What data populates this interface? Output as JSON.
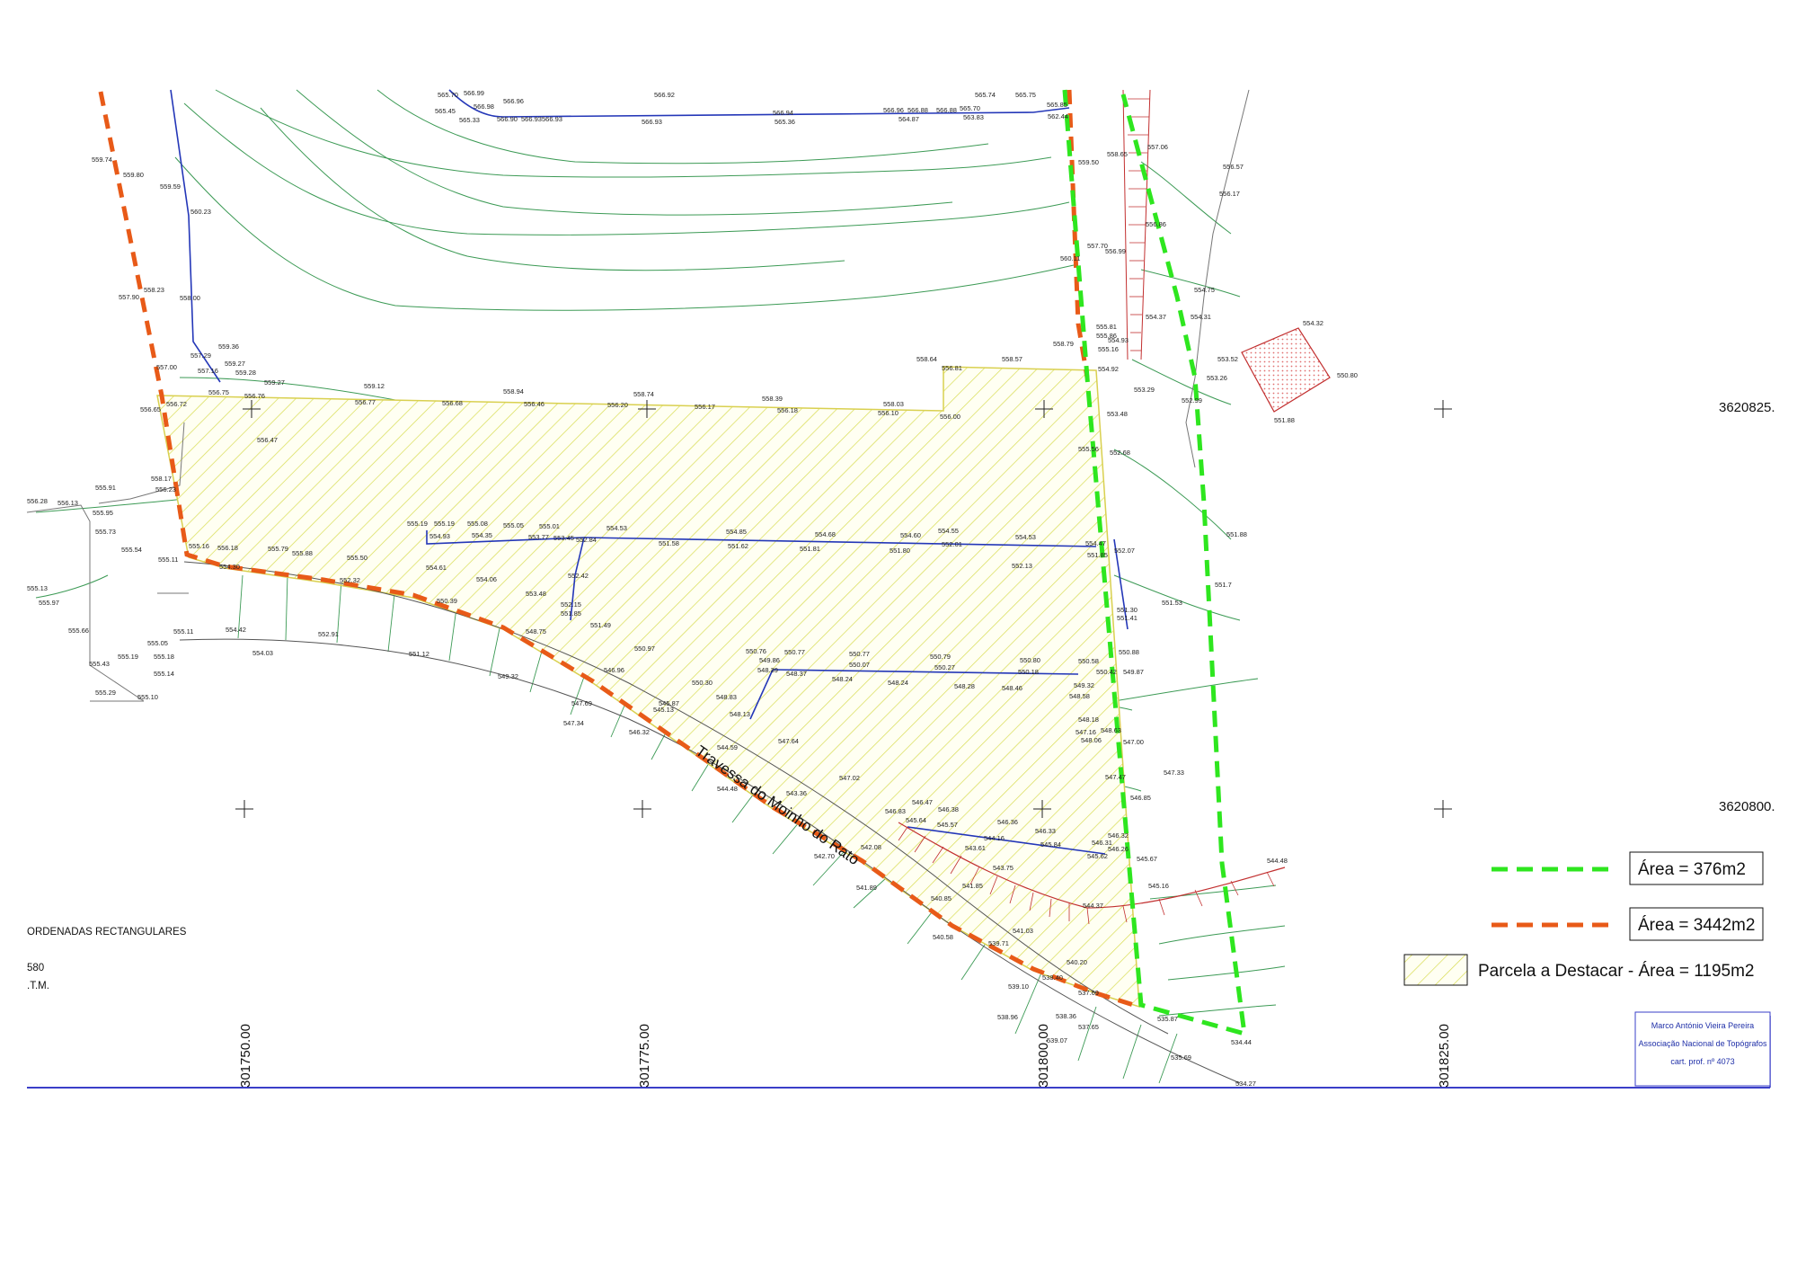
{
  "legend": {
    "green_label": "Área = 376m2",
    "orange_label": "Área = 3442m2",
    "hatch_label": "Parcela a Destacar - Área = 1195m2"
  },
  "notes": {
    "line1": "ORDENADAS RECTANGULARES",
    "line2": "580",
    "line3": ".T.M."
  },
  "credit": {
    "name": "Marco António Vieira Pereira",
    "association": "Associação Nacional de Topógrafos",
    "license": "cart. prof. nº 4073"
  },
  "street_name": "Travessa do Moinho do Rato",
  "coordinates": {
    "x_labels": [
      "301750.00",
      "301775.00",
      "301800.00",
      "301825.00"
    ],
    "y_labels": [
      "3620825.",
      "3620800."
    ]
  },
  "elevations": [
    "565.70",
    "566.99",
    "566.96",
    "566.92",
    "565.74",
    "565.75",
    "565.45",
    "566.98",
    "565.33",
    "566.90",
    "566.93",
    "566.93",
    "566.94",
    "566.96",
    "566.88",
    "566.88",
    "565.70",
    "565.85",
    "566.93",
    "565.36",
    "564.87",
    "563.83",
    "562.44",
    "559.74",
    "559.80",
    "559.59",
    "560.23",
    "558.23",
    "557.90",
    "558.00",
    "559.36",
    "557.29",
    "559.27",
    "557.16",
    "559.28",
    "559.27",
    "557.00",
    "559.12",
    "558.94",
    "558.74",
    "558.39",
    "558.64",
    "558.57",
    "558.79",
    "556.72",
    "556.65",
    "556.77",
    "556.68",
    "556.46",
    "556.20",
    "556.17",
    "556.18",
    "556.10",
    "558.03",
    "556.00",
    "556.81",
    "556.75",
    "556.76",
    "556.47",
    "558.17",
    "556.23",
    "555.91",
    "555.95",
    "555.73",
    "556.28",
    "556.13",
    "555.54",
    "555.11",
    "555.16",
    "556.18",
    "555.79",
    "555.88",
    "555.50",
    "554.30",
    "552.32",
    "555.19",
    "555.19",
    "555.08",
    "555.05",
    "555.01",
    "554.53",
    "554.85",
    "554.68",
    "554.60",
    "554.55",
    "554.53",
    "554.93",
    "554.35",
    "553.77",
    "553.45",
    "552.84",
    "551.58",
    "551.62",
    "551.81",
    "551.80",
    "552.01",
    "552.13",
    "554.61",
    "554.06",
    "553.48",
    "552.42",
    "552.15",
    "551.85",
    "551.49",
    "550.97",
    "550.30",
    "549.32",
    "548.75",
    "547.69",
    "547.34",
    "546.32",
    "546.96",
    "545.87",
    "545.13",
    "544.59",
    "544.48",
    "543.36",
    "542.70",
    "541.89",
    "540.85",
    "540.58",
    "539.71",
    "539.10",
    "538.96",
    "538.36",
    "539.07",
    "537.65",
    "535.87",
    "535.69",
    "534.44",
    "534.27",
    "550.76",
    "550.77",
    "550.77",
    "550.79",
    "550.80",
    "550.58",
    "550.42",
    "549.87",
    "550.88",
    "550.07",
    "550.27",
    "550.18",
    "549.86",
    "548.39",
    "548.37",
    "548.24",
    "548.24",
    "548.28",
    "548.46",
    "549.32",
    "548.58",
    "548.18",
    "547.16",
    "548.63",
    "548.06",
    "547.00",
    "548.83",
    "548.13",
    "547.64",
    "547.02",
    "546.47",
    "546.38",
    "546.36",
    "546.33",
    "545.84",
    "546.32",
    "546.31",
    "546.26",
    "545.62",
    "545.67",
    "546.85",
    "547.47",
    "547.33",
    "545.16",
    "544.48",
    "544.37",
    "543.75",
    "541.85",
    "541.03",
    "540.20",
    "538.40",
    "537.69",
    "542.08",
    "543.61",
    "544.16",
    "545.57",
    "545.64",
    "546.83",
    "550.39",
    "551.12",
    "554.42",
    "554.03",
    "552.91",
    "555.10",
    "555.11",
    "555.05",
    "555.18",
    "555.14",
    "555.19",
    "555.29",
    "555.43",
    "555.66",
    "555.97",
    "555.13",
    "557.06",
    "558.65",
    "559.50",
    "556.57",
    "556.17",
    "556.86",
    "557.70",
    "556.99",
    "560.11",
    "554.75",
    "554.37",
    "554.31",
    "555.81",
    "555.86",
    "554.93",
    "555.16",
    "554.92",
    "553.29",
    "552.99",
    "553.52",
    "553.26",
    "554.32",
    "550.80",
    "551.88",
    "553.48",
    "555.56",
    "552.68",
    "552.07",
    "551.85",
    "551.88",
    "551.53",
    "551.30",
    "551.41",
    "554.47",
    "551.7"
  ]
}
